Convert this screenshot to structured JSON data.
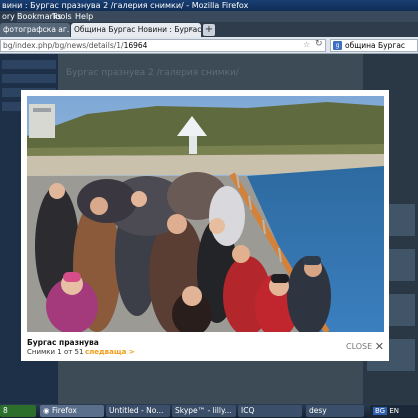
{
  "window": {
    "title": "вини : Бургас празнува 2 /галерия снимки/ - Mozilla Firefox"
  },
  "menu": {
    "items": [
      "ory",
      "Bookmarks",
      "Tools",
      "Help"
    ]
  },
  "tabs": [
    {
      "label": "фотографска аг..."
    },
    {
      "label": "Община Бургас Новини : Бургас пр..."
    }
  ],
  "tab_close": "x",
  "new_tab": "+",
  "address": {
    "prefix": "bg/index.php/bg/news/details/1/",
    "id": "16964"
  },
  "search": {
    "value": "община Бургас",
    "engine_icon": "g"
  },
  "background_heading": "Бургас празнува 2 /галерия снимки/",
  "lightbox": {
    "caption_title": "Бургас празнува",
    "counter": "Снимки 1 от 51",
    "next_label": "следваща >",
    "close_label": "CLOSE",
    "close_icon": "✕"
  },
  "taskbar": {
    "start": "8",
    "items": [
      "Firefox",
      "Untitled - No...",
      "Skype™ - lilly...",
      "ICQ",
      "desy"
    ],
    "tray_lang": "BG",
    "tray_other": "EN"
  },
  "icons": [
    "star-icon",
    "reload-icon",
    "search-engine-icon",
    "close-icon",
    "firefox-icon"
  ]
}
